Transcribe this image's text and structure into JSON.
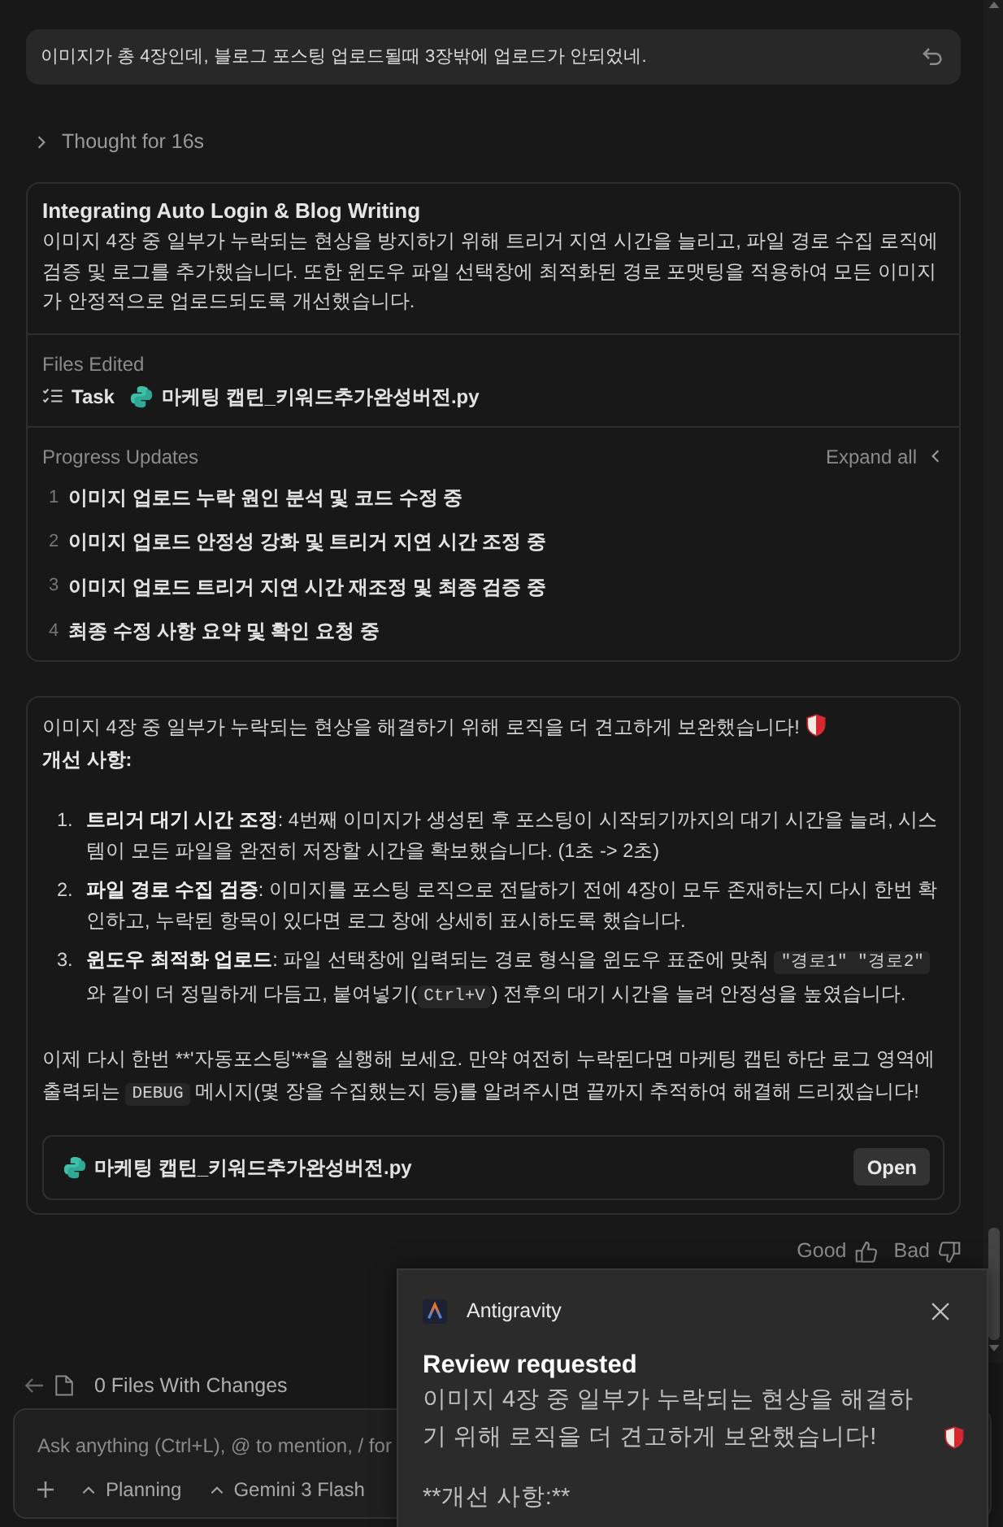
{
  "user_message": {
    "text": "이미지가 총 4장인데, 블로그 포스팅 업로드될때 3장밖에 업로드가 안되었네."
  },
  "thought": {
    "label": "Thought for 16s",
    "expanded": false
  },
  "task_card": {
    "title": "Integrating Auto Login & Blog Writing",
    "summary": "이미지 4장 중 일부가 누락되는 현상을 방지하기 위해 트리거 지연 시간을 늘리고, 파일 경로 수집 로직에 검증 및 로그를 추가했습니다. 또한 윈도우 파일 선택창에 최적화된 경로 포맷팅을 적용하여 모든 이미지가 안정적으로 업로드되도록 개선했습니다.",
    "files_label": "Files Edited",
    "files": [
      {
        "kind": "task",
        "name": "Task"
      },
      {
        "kind": "python",
        "name": "마케팅 캡틴_키워드추가완성버전.py"
      }
    ],
    "progress_label": "Progress Updates",
    "expand_label": "Expand all",
    "steps": [
      {
        "number": "1",
        "text": "이미지 업로드 누락 원인 분석 및 코드 수정 중"
      },
      {
        "number": "2",
        "text": "이미지 업로드 안정성 강화 및 트리거 지연 시간 조정 중"
      },
      {
        "number": "3",
        "text": "이미지 업로드 트리거 지연 시간 재조정 및 최종 검증 중"
      },
      {
        "number": "4",
        "text": "최종 수정 사항 요약 및 확인 요청 중"
      }
    ]
  },
  "response": {
    "intro": "이미지 4장 중 일부가 누락되는 현상을 해결하기 위해 로직을 더 견고하게 보완했습니다!",
    "heading": "개선 사항:",
    "items": [
      {
        "number": "1.",
        "segments": [
          {
            "kind": "bold",
            "text": "트리거 대기 시간 조정"
          },
          {
            "kind": "text",
            "text": ": 4번째 이미지가 생성된 후 포스팅이 시작되기까지의 대기 시간을 늘려, 시스템이 모든 파일을 완전히 저장할 시간을 확보했습니다. (1초 -> 2초)"
          }
        ]
      },
      {
        "number": "2.",
        "segments": [
          {
            "kind": "bold",
            "text": "파일 경로 수집 검증"
          },
          {
            "kind": "text",
            "text": ": 이미지를 포스팅 로직으로 전달하기 전에 4장이 모두 존재하는지 다시 한번 확인하고, 누락된 항목이 있다면 로그 창에 상세히 표시하도록 했습니다."
          }
        ]
      },
      {
        "number": "3.",
        "segments": [
          {
            "kind": "bold",
            "text": "윈도우 최적화 업로드"
          },
          {
            "kind": "text",
            "text": ": 파일 선택창에 입력되는 경로 형식을 윈도우 표준에 맞춰 "
          },
          {
            "kind": "code",
            "text": "\"경로1\" \"경로2\""
          },
          {
            "kind": "text",
            "text": " 와 같이 더 정밀하게 다듬고, 붙여넣기("
          },
          {
            "kind": "code",
            "text": "Ctrl+V"
          },
          {
            "kind": "text",
            "text": ") 전후의 대기 시간을 늘려 안정성을 높였습니다."
          }
        ]
      }
    ],
    "closing": [
      {
        "kind": "text",
        "text": "이제 다시 한번 **'자동포스팅'**을 실행해 보세요. 만약 여전히 누락된다면 마케팅 캡틴 하단 로그 영역에 출력되는 "
      },
      {
        "kind": "code",
        "text": "DEBUG"
      },
      {
        "kind": "text",
        "text": " 메시지(몇 장을 수집했는지 등)를 알려주시면 끝까지 추적하여 해결해 드리겠습니다!"
      }
    ],
    "file": {
      "name": "마케팅 캡틴_키워드추가완성버전.py",
      "action": "Open"
    }
  },
  "feedback": {
    "good": "Good",
    "bad": "Bad"
  },
  "changes_bar": {
    "label": "0 Files With Changes"
  },
  "composer": {
    "placeholder": "Ask anything (Ctrl+L), @ to mention, / for",
    "dropdowns": [
      {
        "label": "Planning"
      },
      {
        "label": "Gemini 3 Flash"
      }
    ]
  },
  "notification": {
    "app": "Antigravity",
    "title": "Review requested",
    "body": [
      "이미지 4장 중 일부가 누락되는 현상을 해결하기 위해 로직을 더 견고하게 보완했습니다!",
      "**개선 사항:**"
    ]
  }
}
